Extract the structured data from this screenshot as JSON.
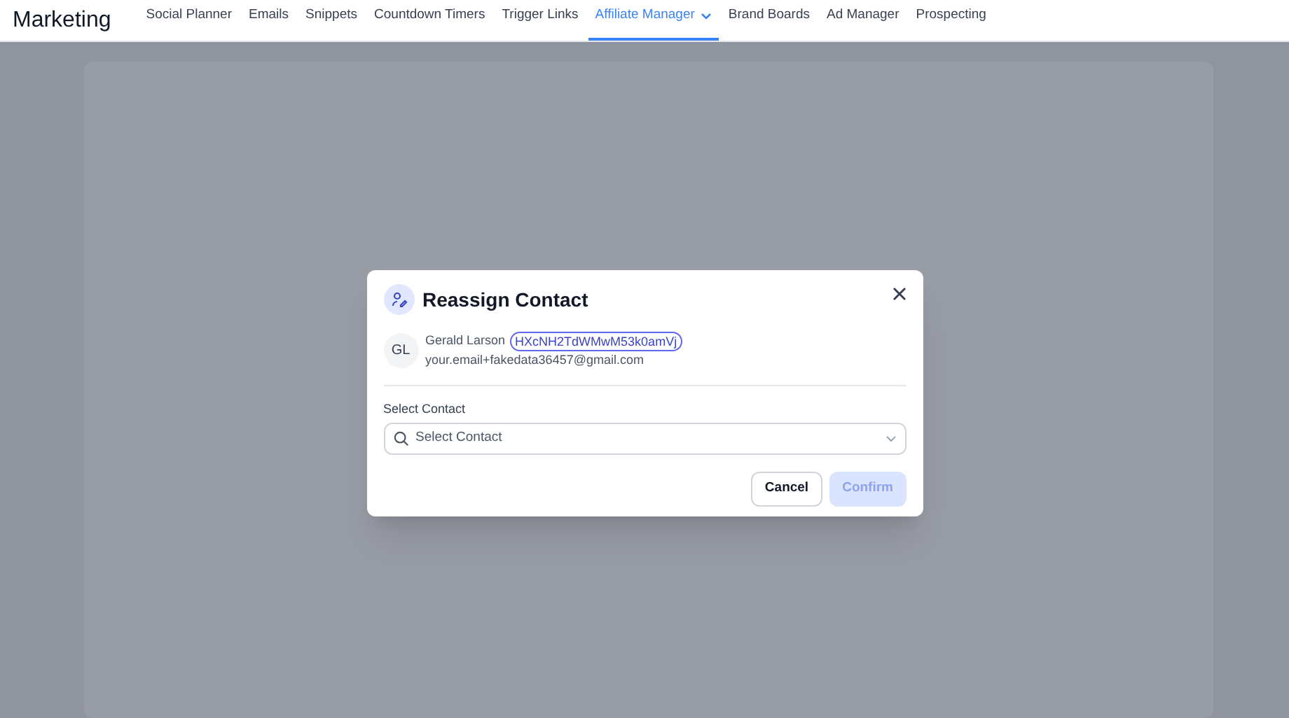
{
  "app_title": "Marketing",
  "tabs": [
    {
      "label": "Social Planner",
      "selected": false
    },
    {
      "label": "Emails",
      "selected": false
    },
    {
      "label": "Snippets",
      "selected": false
    },
    {
      "label": "Countdown Timers",
      "selected": false
    },
    {
      "label": "Trigger Links",
      "selected": false
    },
    {
      "label": "Affiliate Manager",
      "selected": true,
      "dropdown": true
    },
    {
      "label": "Brand Boards",
      "selected": false
    },
    {
      "label": "Ad Manager",
      "selected": false
    },
    {
      "label": "Prospecting",
      "selected": false
    }
  ],
  "dialog": {
    "title": "Reassign Contact",
    "contact": {
      "initials": "GL",
      "name": "Gerald Larson",
      "id": "HXcNH2TdWMwM53k0amVj",
      "email": "your.email+fakedata36457@gmail.com"
    },
    "field": {
      "label": "Select Contact",
      "placeholder": "Select Contact"
    },
    "buttons": [
      {
        "label": "Cancel",
        "kind": "secondary",
        "disabled": false
      },
      {
        "label": "Confirm",
        "kind": "primary",
        "disabled": true
      }
    ]
  }
}
